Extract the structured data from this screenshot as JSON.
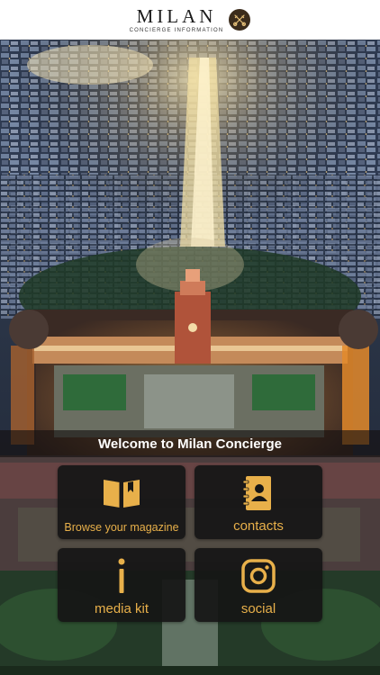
{
  "header": {
    "logo_title": "MILAN",
    "logo_subtitle": "CONCIERGE INFORMATION",
    "badge_icon": "crossed-keys-icon"
  },
  "welcome": {
    "text": "Welcome to Milan Concierge"
  },
  "menu": {
    "items": [
      {
        "label": "Browse your magazine",
        "icon": "open-book-icon"
      },
      {
        "label": "contacts",
        "icon": "address-book-icon"
      },
      {
        "label": "media kit",
        "icon": "info-icon"
      },
      {
        "label": "social",
        "icon": "instagram-icon"
      }
    ]
  },
  "colors": {
    "accent": "#e8b04a",
    "tile_bg": "#161616",
    "header_bg": "#ffffff",
    "badge_bg": "#3b2c1c"
  }
}
